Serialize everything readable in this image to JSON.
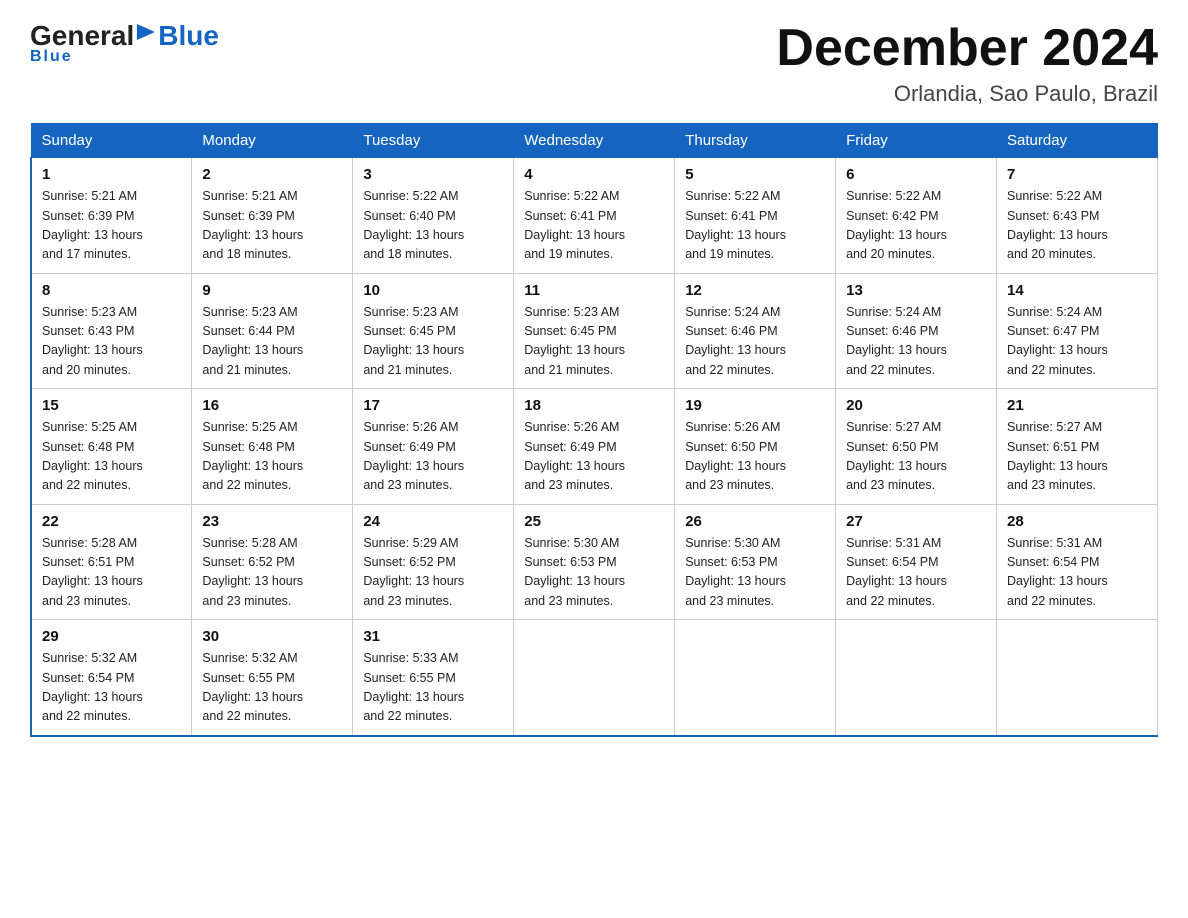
{
  "header": {
    "logo_general": "General",
    "logo_blue": "Blue",
    "month_title": "December 2024",
    "location": "Orlandia, Sao Paulo, Brazil"
  },
  "weekdays": [
    "Sunday",
    "Monday",
    "Tuesday",
    "Wednesday",
    "Thursday",
    "Friday",
    "Saturday"
  ],
  "weeks": [
    [
      {
        "day": "1",
        "sunrise": "5:21 AM",
        "sunset": "6:39 PM",
        "daylight": "13 hours and 17 minutes."
      },
      {
        "day": "2",
        "sunrise": "5:21 AM",
        "sunset": "6:39 PM",
        "daylight": "13 hours and 18 minutes."
      },
      {
        "day": "3",
        "sunrise": "5:22 AM",
        "sunset": "6:40 PM",
        "daylight": "13 hours and 18 minutes."
      },
      {
        "day": "4",
        "sunrise": "5:22 AM",
        "sunset": "6:41 PM",
        "daylight": "13 hours and 19 minutes."
      },
      {
        "day": "5",
        "sunrise": "5:22 AM",
        "sunset": "6:41 PM",
        "daylight": "13 hours and 19 minutes."
      },
      {
        "day": "6",
        "sunrise": "5:22 AM",
        "sunset": "6:42 PM",
        "daylight": "13 hours and 20 minutes."
      },
      {
        "day": "7",
        "sunrise": "5:22 AM",
        "sunset": "6:43 PM",
        "daylight": "13 hours and 20 minutes."
      }
    ],
    [
      {
        "day": "8",
        "sunrise": "5:23 AM",
        "sunset": "6:43 PM",
        "daylight": "13 hours and 20 minutes."
      },
      {
        "day": "9",
        "sunrise": "5:23 AM",
        "sunset": "6:44 PM",
        "daylight": "13 hours and 21 minutes."
      },
      {
        "day": "10",
        "sunrise": "5:23 AM",
        "sunset": "6:45 PM",
        "daylight": "13 hours and 21 minutes."
      },
      {
        "day": "11",
        "sunrise": "5:23 AM",
        "sunset": "6:45 PM",
        "daylight": "13 hours and 21 minutes."
      },
      {
        "day": "12",
        "sunrise": "5:24 AM",
        "sunset": "6:46 PM",
        "daylight": "13 hours and 22 minutes."
      },
      {
        "day": "13",
        "sunrise": "5:24 AM",
        "sunset": "6:46 PM",
        "daylight": "13 hours and 22 minutes."
      },
      {
        "day": "14",
        "sunrise": "5:24 AM",
        "sunset": "6:47 PM",
        "daylight": "13 hours and 22 minutes."
      }
    ],
    [
      {
        "day": "15",
        "sunrise": "5:25 AM",
        "sunset": "6:48 PM",
        "daylight": "13 hours and 22 minutes."
      },
      {
        "day": "16",
        "sunrise": "5:25 AM",
        "sunset": "6:48 PM",
        "daylight": "13 hours and 22 minutes."
      },
      {
        "day": "17",
        "sunrise": "5:26 AM",
        "sunset": "6:49 PM",
        "daylight": "13 hours and 23 minutes."
      },
      {
        "day": "18",
        "sunrise": "5:26 AM",
        "sunset": "6:49 PM",
        "daylight": "13 hours and 23 minutes."
      },
      {
        "day": "19",
        "sunrise": "5:26 AM",
        "sunset": "6:50 PM",
        "daylight": "13 hours and 23 minutes."
      },
      {
        "day": "20",
        "sunrise": "5:27 AM",
        "sunset": "6:50 PM",
        "daylight": "13 hours and 23 minutes."
      },
      {
        "day": "21",
        "sunrise": "5:27 AM",
        "sunset": "6:51 PM",
        "daylight": "13 hours and 23 minutes."
      }
    ],
    [
      {
        "day": "22",
        "sunrise": "5:28 AM",
        "sunset": "6:51 PM",
        "daylight": "13 hours and 23 minutes."
      },
      {
        "day": "23",
        "sunrise": "5:28 AM",
        "sunset": "6:52 PM",
        "daylight": "13 hours and 23 minutes."
      },
      {
        "day": "24",
        "sunrise": "5:29 AM",
        "sunset": "6:52 PM",
        "daylight": "13 hours and 23 minutes."
      },
      {
        "day": "25",
        "sunrise": "5:30 AM",
        "sunset": "6:53 PM",
        "daylight": "13 hours and 23 minutes."
      },
      {
        "day": "26",
        "sunrise": "5:30 AM",
        "sunset": "6:53 PM",
        "daylight": "13 hours and 23 minutes."
      },
      {
        "day": "27",
        "sunrise": "5:31 AM",
        "sunset": "6:54 PM",
        "daylight": "13 hours and 22 minutes."
      },
      {
        "day": "28",
        "sunrise": "5:31 AM",
        "sunset": "6:54 PM",
        "daylight": "13 hours and 22 minutes."
      }
    ],
    [
      {
        "day": "29",
        "sunrise": "5:32 AM",
        "sunset": "6:54 PM",
        "daylight": "13 hours and 22 minutes."
      },
      {
        "day": "30",
        "sunrise": "5:32 AM",
        "sunset": "6:55 PM",
        "daylight": "13 hours and 22 minutes."
      },
      {
        "day": "31",
        "sunrise": "5:33 AM",
        "sunset": "6:55 PM",
        "daylight": "13 hours and 22 minutes."
      },
      null,
      null,
      null,
      null
    ]
  ],
  "labels": {
    "sunrise_prefix": "Sunrise: ",
    "sunset_prefix": "Sunset: ",
    "daylight_prefix": "Daylight: "
  }
}
